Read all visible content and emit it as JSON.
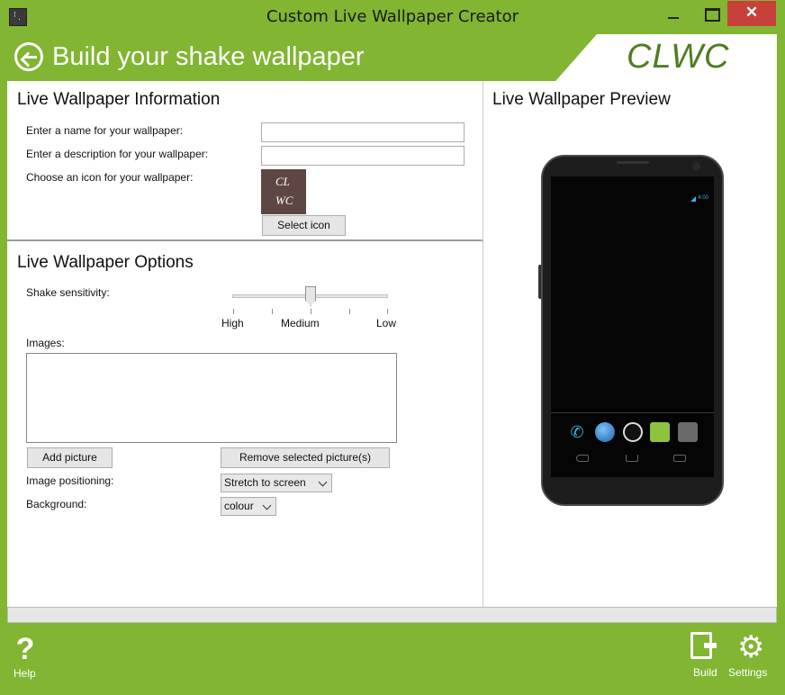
{
  "window": {
    "title": "Custom Live Wallpaper Creator",
    "close_glyph": "✕"
  },
  "header": {
    "title": "Build your shake wallpaper",
    "logo": "CLWC"
  },
  "info_section": {
    "title": "Live Wallpaper Information",
    "name_label": "Enter a name for your wallpaper:",
    "name_value": "",
    "description_label": "Enter a description for your wallpaper:",
    "description_value": "",
    "icon_label": "Choose an icon for your wallpaper:",
    "icon_text_line1": "CL",
    "icon_text_line2": "WC",
    "select_icon_button": "Select icon"
  },
  "options_section": {
    "title": "Live Wallpaper Options",
    "shake_label": "Shake sensitivity:",
    "slider_levels": [
      "High",
      "Medium",
      "Low"
    ],
    "slider_value": "Medium",
    "images_label": "Images:",
    "images": [],
    "add_picture_button": "Add picture",
    "remove_picture_button": "Remove selected picture(s)",
    "positioning_label": "Image positioning:",
    "positioning_value": "Stretch to screen",
    "background_label": "Background:",
    "background_value": "colour"
  },
  "preview": {
    "title": "Live Wallpaper Preview",
    "status_time": "4:00"
  },
  "footer": {
    "help_label": "Help",
    "help_glyph": "?",
    "build_label": "Build",
    "settings_label": "Settings",
    "settings_glyph": "⚙"
  },
  "progress": {
    "value": 0.0
  },
  "colors": {
    "accent_green": "#81b532",
    "logo_green": "#4f7d1f",
    "close_red": "#c7413a"
  }
}
